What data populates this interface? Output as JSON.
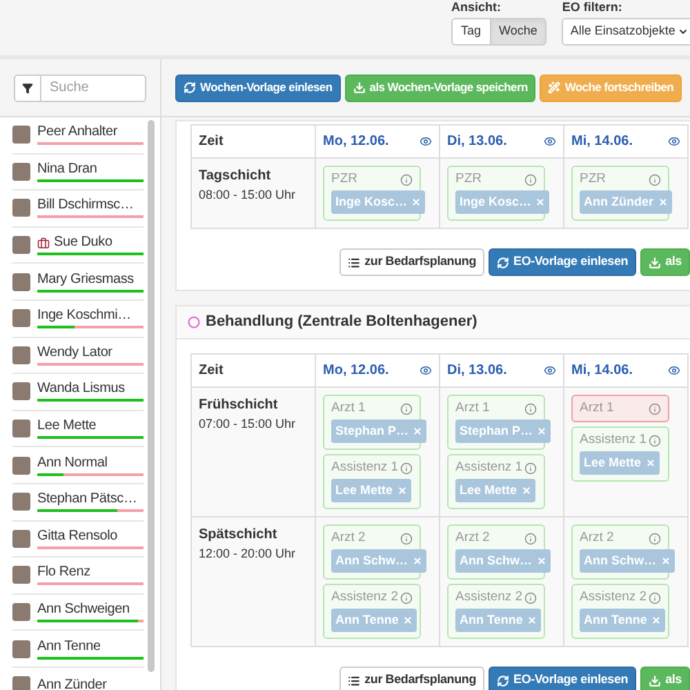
{
  "view": {
    "label": "Ansicht:",
    "options": [
      {
        "label": "Tag",
        "selected": false
      },
      {
        "label": "Woche",
        "selected": true
      }
    ]
  },
  "eo_filter": {
    "label": "EO filtern:",
    "value": "Alle Einsatzobjekte"
  },
  "sidebar": {
    "search": {
      "placeholder": "Suche"
    },
    "people": [
      {
        "name": "Peer Anhalter",
        "level": 0,
        "medical": false
      },
      {
        "name": "Nina Dran",
        "level": 1,
        "medical": false
      },
      {
        "name": "Bill Dschirmsc…",
        "level": 0,
        "medical": false
      },
      {
        "name": "Sue Duko",
        "level": 1,
        "medical": true
      },
      {
        "name": "Mary Griesmass",
        "level": 1,
        "medical": false
      },
      {
        "name": "Inge Koschmi…",
        "level": 0.35,
        "medical": false
      },
      {
        "name": "Wendy Lator",
        "level": 0,
        "medical": false
      },
      {
        "name": "Wanda Lismus",
        "level": 1,
        "medical": false
      },
      {
        "name": "Lee Mette",
        "level": 1,
        "medical": false
      },
      {
        "name": "Ann Normal",
        "level": 0.25,
        "medical": false
      },
      {
        "name": "Stephan Pätsc…",
        "level": 0.75,
        "medical": false
      },
      {
        "name": "Gitta Rensolo",
        "level": 0,
        "medical": false
      },
      {
        "name": "Flo Renz",
        "level": 0,
        "medical": false
      },
      {
        "name": "Ann Schweigen",
        "level": 0.95,
        "medical": false
      },
      {
        "name": "Ann Tenne",
        "level": 1,
        "medical": false
      },
      {
        "name": "Ann Zünder",
        "medical": false
      }
    ]
  },
  "toolbar": [
    {
      "label": "Wochen-Vorlage einlesen",
      "kind": "load"
    },
    {
      "label": "als Wochen-Vorlage speichern",
      "kind": "save"
    },
    {
      "label": "Woche fortschreiben",
      "kind": "forward"
    }
  ],
  "sections": [
    {
      "columns": [
        "Zeit",
        "Mo, 12.06.",
        "Di, 13.06.",
        "Mi, 14.06."
      ],
      "shifts": [
        {
          "name": "Tagschicht",
          "time": "08:00 - 15:00 Uhr",
          "days": [
            [
              {
                "role": "PZR",
                "missing": false,
                "assignees": [
                  "Inge Kosc…"
                ]
              }
            ],
            [
              {
                "role": "PZR",
                "missing": false,
                "assignees": [
                  "Inge Kosc…"
                ]
              }
            ],
            [
              {
                "role": "PZR",
                "missing": false,
                "assignees": [
                  "Ann Zünder"
                ]
              }
            ]
          ]
        }
      ],
      "actions": [
        {
          "label": "zur Bedarfsplanung",
          "kind": "plan"
        },
        {
          "label": "EO-Vorlage einlesen",
          "kind": "load"
        },
        {
          "label": "als",
          "kind": "save"
        }
      ]
    },
    {
      "title": "Behandlung (Zentrale Boltenhagener)",
      "columns": [
        "Zeit",
        "Mo, 12.06.",
        "Di, 13.06.",
        "Mi, 14.06."
      ],
      "shifts": [
        {
          "name": "Frühschicht",
          "time": "07:00 - 15:00 Uhr",
          "days": [
            [
              {
                "role": "Arzt 1",
                "missing": false,
                "assignees": [
                  "Stephan P…"
                ]
              },
              {
                "role": "Assistenz 1",
                "missing": false,
                "assignees": [
                  "Lee Mette"
                ]
              }
            ],
            [
              {
                "role": "Arzt 1",
                "missing": false,
                "assignees": [
                  "Stephan P…"
                ]
              },
              {
                "role": "Assistenz 1",
                "missing": false,
                "assignees": [
                  "Lee Mette"
                ]
              }
            ],
            [
              {
                "role": "Arzt 1",
                "missing": true
              },
              {
                "role": "Assistenz 1",
                "missing": false,
                "assignees": [
                  "Lee Mette"
                ]
              }
            ]
          ]
        },
        {
          "name": "Spätschicht",
          "time": "12:00 - 20:00 Uhr",
          "days": [
            [
              {
                "role": "Arzt 2",
                "missing": false,
                "assignees": [
                  "Ann Schw…"
                ]
              },
              {
                "role": "Assistenz 2",
                "missing": false,
                "assignees": [
                  "Ann Tenne"
                ]
              }
            ],
            [
              {
                "role": "Arzt 2",
                "missing": false,
                "assignees": [
                  "Ann Schw…"
                ]
              },
              {
                "role": "Assistenz 2",
                "missing": false,
                "assignees": [
                  "Ann Tenne"
                ]
              }
            ],
            [
              {
                "role": "Arzt 2",
                "missing": false,
                "assignees": [
                  "Ann Schw…"
                ]
              },
              {
                "role": "Assistenz 2",
                "missing": false,
                "assignees": [
                  "Ann Tenne"
                ]
              }
            ]
          ]
        }
      ],
      "actions": [
        {
          "label": "zur Bedarfsplanung",
          "kind": "plan"
        },
        {
          "label": "EO-Vorlage einlesen",
          "kind": "load"
        },
        {
          "label": "als",
          "kind": "save"
        }
      ]
    }
  ]
}
